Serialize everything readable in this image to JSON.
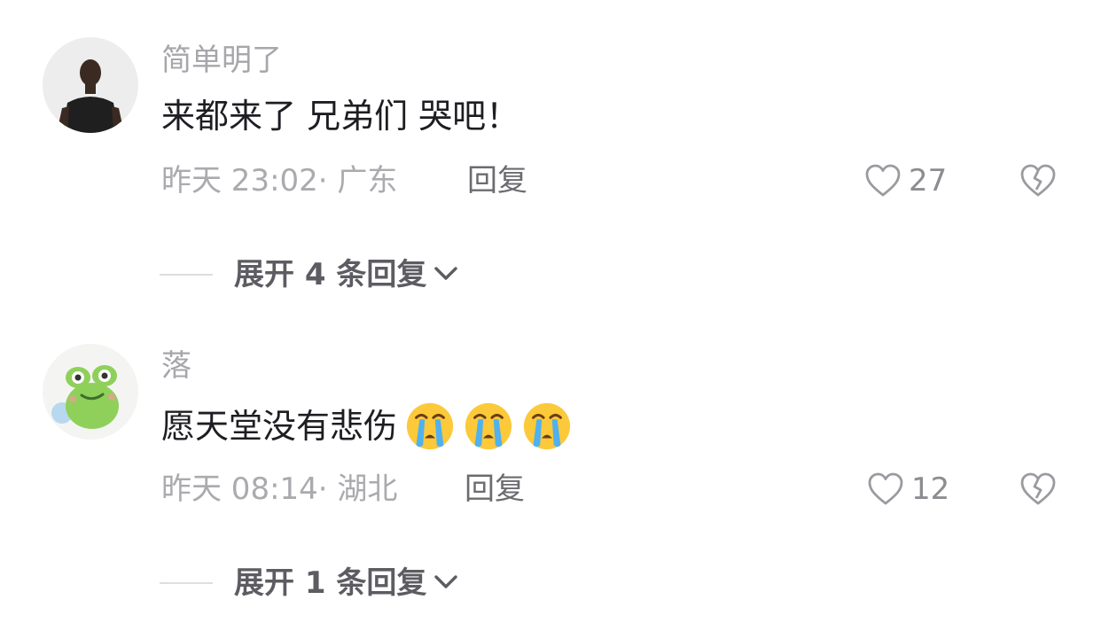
{
  "comments": [
    {
      "username": "简单明了",
      "text": "来都来了 兄弟们 哭吧！",
      "time": "昨天 23:02",
      "location": "· 广东",
      "reply_label": "回复",
      "likes": "27",
      "expand_label": "展开 4 条回复",
      "avatar_icon": "man-in-black-shirt-avatar"
    },
    {
      "username": "落",
      "text": "愿天堂没有悲伤",
      "emojis": [
        "crying-face-emoji",
        "crying-face-emoji",
        "crying-face-emoji"
      ],
      "time": "昨天 08:14",
      "location": "· 湖北",
      "reply_label": "回复",
      "likes": "12",
      "expand_label": "展开 1 条回复",
      "avatar_icon": "green-frog-avatar"
    }
  ],
  "icons": {
    "like": "heart-outline-icon",
    "dislike": "broken-heart-icon",
    "expand": "chevron-down-icon"
  },
  "colors": {
    "username": "#a6a6ab",
    "text": "#1d1d22",
    "meta": "#aaaaaf",
    "reply": "#6b6b70",
    "expand": "#5c5c62"
  }
}
